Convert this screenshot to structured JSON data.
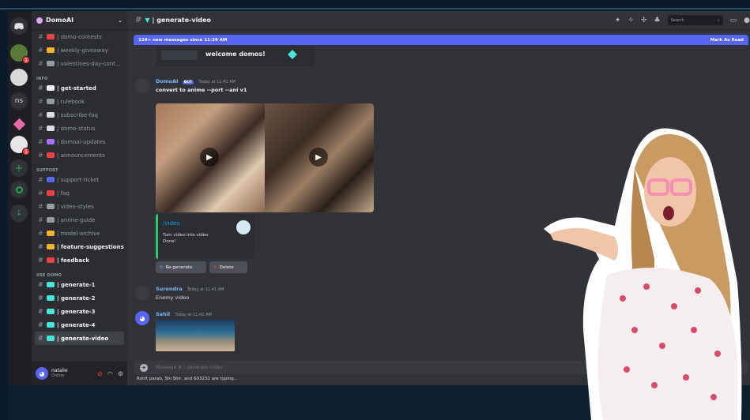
{
  "server": {
    "name": "DomoAI"
  },
  "rail": {
    "items": [
      {
        "icon": "discord-logo-icon",
        "label": ""
      },
      {
        "icon": "turtle-server-icon",
        "label": "",
        "badge": "1"
      },
      {
        "icon": "dice-server-icon",
        "label": ""
      },
      {
        "icon": "ns-server-icon",
        "label": "ns"
      },
      {
        "icon": "gem-server-icon",
        "label": ""
      },
      {
        "icon": "domo-server-icon",
        "label": "",
        "badge": "1"
      },
      {
        "icon": "add-server-icon",
        "label": "+"
      },
      {
        "icon": "explore-icon",
        "label": ""
      },
      {
        "icon": "download-icon",
        "label": ""
      }
    ]
  },
  "sidebar": {
    "top_channels": [
      {
        "label": "domo-contests",
        "color": "#f23f43"
      },
      {
        "label": "weekly-giveaway",
        "color": "#f0b232"
      },
      {
        "label": "valentines-day-cont...",
        "color": "#949ba4"
      }
    ],
    "info_category": "INFO",
    "info_channels": [
      {
        "label": "get-started",
        "color": "#f2f3f5",
        "bold": true
      },
      {
        "label": "rulebook",
        "color": "#949ba4"
      },
      {
        "label": "subscribe-faq",
        "color": "#dbdee1"
      },
      {
        "label": "domo-status",
        "color": "#dbdee1"
      },
      {
        "label": "domoai-updates",
        "color": "#a970ff"
      },
      {
        "label": "announcements",
        "color": "#f23f43"
      }
    ],
    "support_category": "SUPPORT",
    "support_channels": [
      {
        "label": "support-ticket",
        "color": "#5865f2"
      },
      {
        "label": "faq",
        "color": "#f23f43"
      },
      {
        "label": "video-styles",
        "color": "#949ba4"
      },
      {
        "label": "anime-guide",
        "color": "#949ba4"
      },
      {
        "label": "model-archive",
        "color": "#f0b232"
      },
      {
        "label": "feature-suggestions",
        "color": "#f0b232",
        "bold": true
      },
      {
        "label": "feedback",
        "color": "#f23f43",
        "bold": true
      }
    ],
    "use_category": "USE DOMO",
    "use_channels": [
      {
        "label": "generate-1",
        "color": "#47e6d8",
        "bold": true
      },
      {
        "label": "generate-2",
        "color": "#47e6d8",
        "bold": true
      },
      {
        "label": "generate-3",
        "color": "#47e6d8",
        "bold": true
      },
      {
        "label": "generate-4",
        "color": "#47e6d8",
        "bold": true
      },
      {
        "label": "generate-video",
        "color": "#47e6d8",
        "bold": true,
        "active": true
      }
    ],
    "user": {
      "name": "natalie",
      "status": "Online"
    }
  },
  "header": {
    "channel": "| generate-video",
    "search_placeholder": "Search",
    "banner_left": "124+ new messages since 11:39 AM",
    "banner_right": "Mark As Read"
  },
  "messages": {
    "welcome": "welcome domos!",
    "m1": {
      "author": "DomoAI",
      "bot": "BOT",
      "stamp": "Today at 11:41 AM",
      "text": "convert to anime --port --ani v1",
      "embed_title": "/video",
      "embed_desc1": "Turn video into video",
      "embed_desc2": "Done!",
      "btn_regen": "Re-generate",
      "btn_delete": "Delete"
    },
    "m2": {
      "author": "Surendra",
      "stamp": "Today at 11:41 AM",
      "text": "Enemy video"
    },
    "m3": {
      "author": "Sahil",
      "stamp": "Today at 11:42 AM"
    }
  },
  "composer": {
    "placeholder": "Message # | generate-video"
  },
  "typing": "Rohit parab, Shi Shir, and 603231 are typing..."
}
